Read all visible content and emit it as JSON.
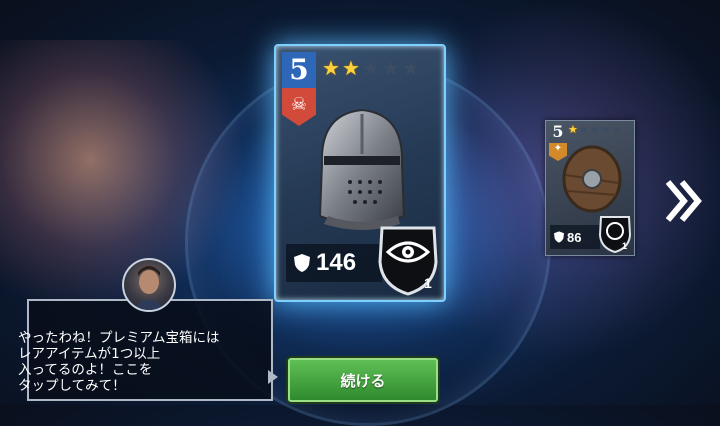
{
  "main_card": {
    "tier": "5",
    "stars_filled": 2,
    "stars_total": 5,
    "power": "146",
    "class_count": "1",
    "icon": "knight-helmet-icon",
    "badge_icon": "demon-skull-icon",
    "class_icon": "eye-icon",
    "power_icon": "armor-shield-icon"
  },
  "side_card": {
    "tier": "5",
    "stars_filled": 1,
    "stars_total": 5,
    "power": "86",
    "class_count": "1",
    "icon": "round-wooden-shield-icon",
    "class_icon": "lion-icon"
  },
  "dialog": {
    "lines": [
      "やったわね！プレミアム宝箱には",
      "レアアイテムが1つ以上",
      "入ってるのよ！ここを",
      "タップしてみて！"
    ]
  },
  "buttons": {
    "continue_label": "続ける"
  },
  "colors": {
    "card_glow": "#7fd0ff",
    "tier_blue": "#2e67b8",
    "badge_red": "#d24a3a",
    "star_gold": "#ffd23a",
    "button_green": "#4aa944"
  }
}
